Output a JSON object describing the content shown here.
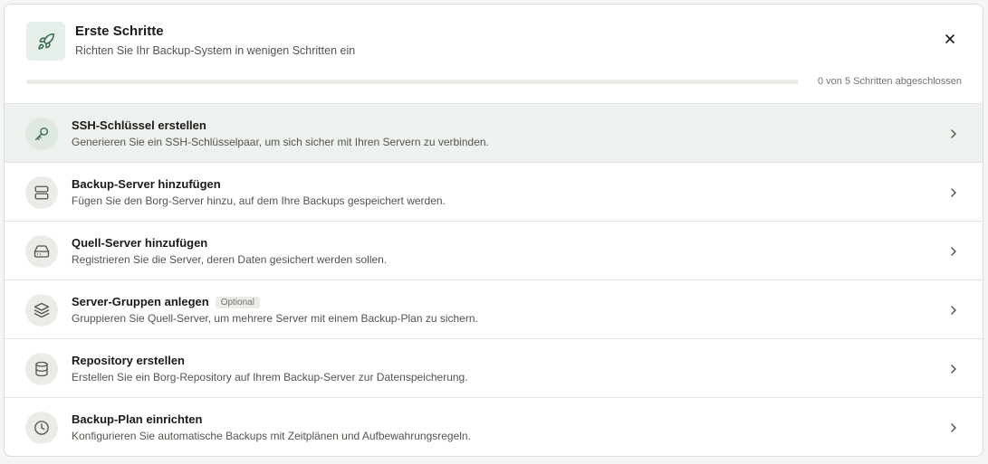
{
  "header": {
    "title": "Erste Schritte",
    "subtitle": "Richten Sie Ihr Backup-System in wenigen Schritten ein",
    "hero_icon": "rocket-icon",
    "close_icon": "close-icon"
  },
  "progress": {
    "completed": 0,
    "total": 5,
    "fraction": 0,
    "text": "0 von 5 Schritten abgeschlossen"
  },
  "colors": {
    "accent": "#2f6a4f",
    "active_row_bg": "#eef2ef",
    "hero_bg": "#e6efe9"
  },
  "steps": [
    {
      "title": "SSH-Schlüssel erstellen",
      "description": "Generieren Sie ein SSH-Schlüsselpaar, um sich sicher mit Ihren Servern zu verbinden.",
      "icon": "key-icon",
      "badge": ""
    },
    {
      "title": "Backup-Server hinzufügen",
      "description": "Fügen Sie den Borg-Server hinzu, auf dem Ihre Backups gespeichert werden.",
      "icon": "server-icon",
      "badge": ""
    },
    {
      "title": "Quell-Server hinzufügen",
      "description": "Registrieren Sie die Server, deren Daten gesichert werden sollen.",
      "icon": "hard-drive-icon",
      "badge": ""
    },
    {
      "title": "Server-Gruppen anlegen",
      "description": "Gruppieren Sie Quell-Server, um mehrere Server mit einem Backup-Plan zu sichern.",
      "icon": "layers-icon",
      "badge": "Optional"
    },
    {
      "title": "Repository erstellen",
      "description": "Erstellen Sie ein Borg-Repository auf Ihrem Backup-Server zur Datenspeicherung.",
      "icon": "database-icon",
      "badge": ""
    },
    {
      "title": "Backup-Plan einrichten",
      "description": "Konfigurieren Sie automatische Backups mit Zeitplänen und Aufbewahrungsregeln.",
      "icon": "clock-icon",
      "badge": ""
    }
  ]
}
